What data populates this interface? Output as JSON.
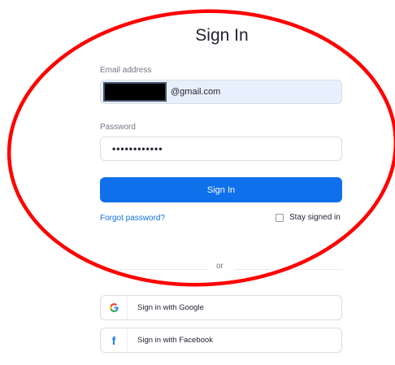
{
  "title": "Sign In",
  "email": {
    "label": "Email address",
    "value": "@gmail.com"
  },
  "password": {
    "label": "Password",
    "value": "••••••••••••"
  },
  "signin_button": "Sign In",
  "forgot_link": "Forgot password?",
  "stay_signed_in": {
    "label": "Stay signed in",
    "checked": false
  },
  "divider_text": "or",
  "social": [
    {
      "label": "Sign in with Google",
      "icon": "google-icon",
      "glyph": "G",
      "color": "#4285f4"
    },
    {
      "label": "Sign in with Facebook",
      "icon": "facebook-icon",
      "glyph": "f",
      "color": "#1877f2"
    }
  ],
  "colors": {
    "accent": "#0e71eb",
    "annotation": "#ff0000"
  }
}
